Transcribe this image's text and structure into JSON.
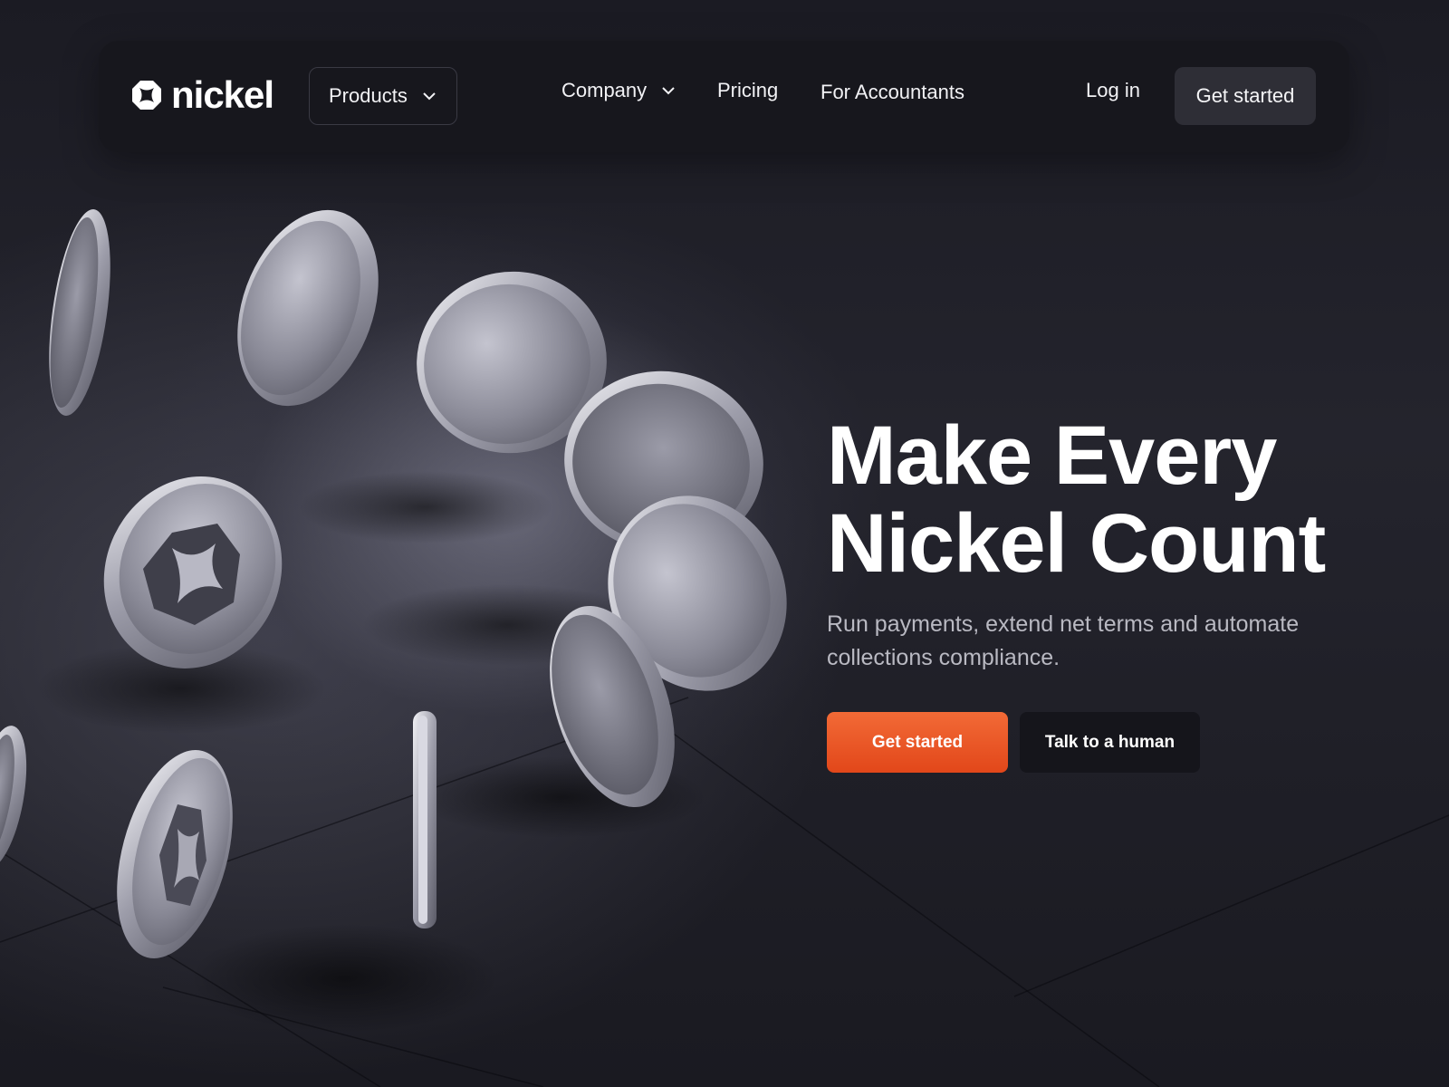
{
  "brand": {
    "name": "nickel",
    "logo_icon": "nickel-logo-icon"
  },
  "nav": {
    "products_label": "Products",
    "company_label": "Company",
    "pricing_label": "Pricing",
    "accountants_label": "For Accountants",
    "login_label": "Log in",
    "cta_label": "Get started"
  },
  "hero": {
    "title_line1": "Make Every",
    "title_line2": "Nickel Count",
    "subtitle": "Run payments, extend net terms and automate collections compliance.",
    "primary_cta": "Get started",
    "secondary_cta": "Talk to a human"
  },
  "colors": {
    "accent": "#e8531f",
    "background": "#1c1c24",
    "nav_bg": "#17171d"
  }
}
